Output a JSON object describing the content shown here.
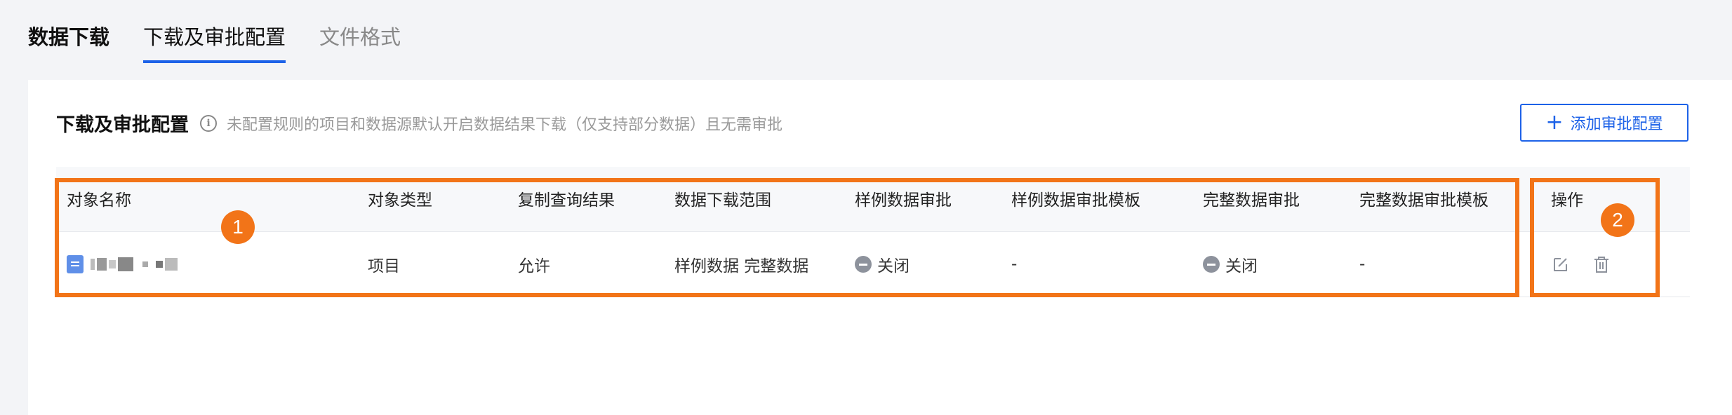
{
  "tabs": [
    {
      "label": "数据下载"
    },
    {
      "label": "下载及审批配置"
    },
    {
      "label": "文件格式"
    }
  ],
  "section": {
    "title": "下载及审批配置",
    "hint": "未配置规则的项目和数据源默认开启数据结果下载（仅支持部分数据）且无需审批",
    "add_button": "添加审批配置"
  },
  "table": {
    "columns": [
      "对象名称",
      "对象类型",
      "复制查询结果",
      "数据下载范围",
      "样例数据审批",
      "样例数据审批模板",
      "完整数据审批",
      "完整数据审批模板",
      "操作"
    ],
    "rows": [
      {
        "object_type": "项目",
        "copy_result": "允许",
        "download_scope": "样例数据 完整数据",
        "sample_approval": "关闭",
        "sample_template": "-",
        "full_approval": "关闭",
        "full_template": "-"
      }
    ]
  },
  "annotations": [
    "1",
    "2"
  ],
  "colors": {
    "accent": "#1d62e8",
    "highlight": "#f27418",
    "closed_status": "#8d929c"
  },
  "icons": {
    "info": "info-icon",
    "object": "document-icon",
    "status": "minus-circle-icon",
    "edit": "edit-icon",
    "delete": "trash-icon"
  }
}
